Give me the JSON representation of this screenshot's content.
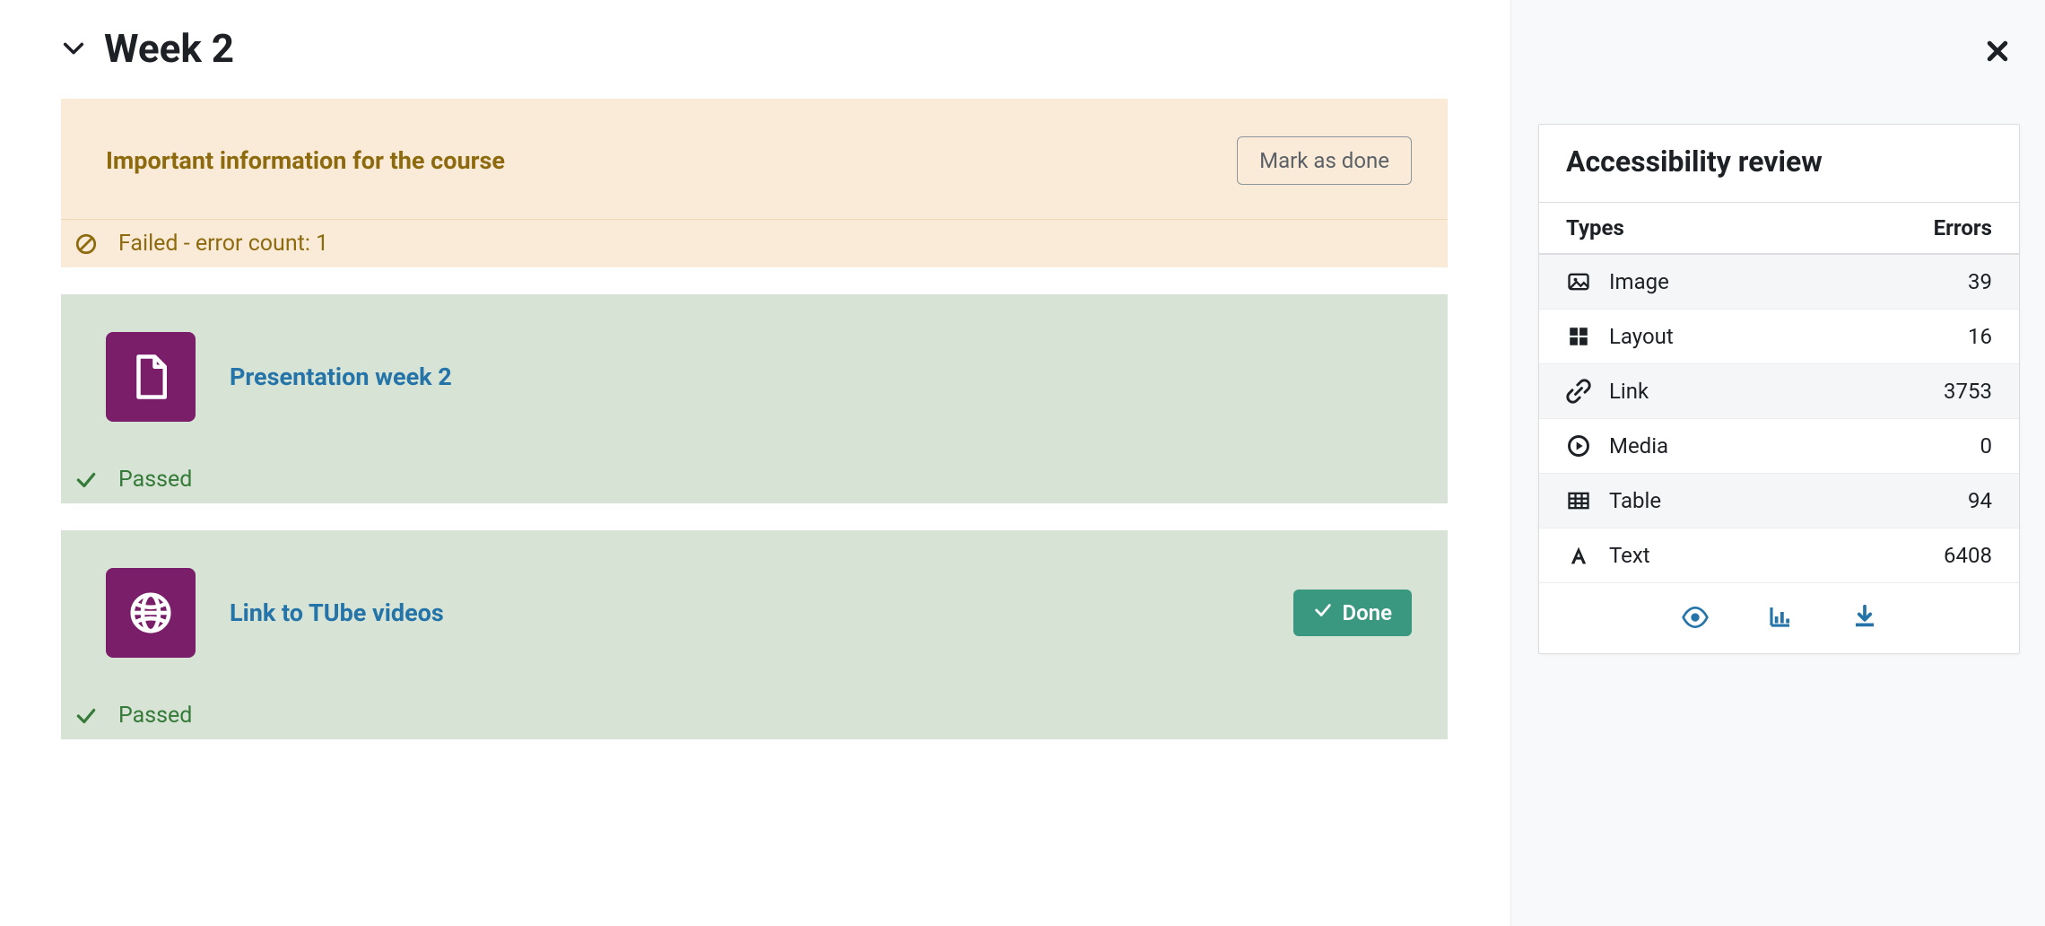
{
  "section": {
    "title": "Week 2"
  },
  "activities": [
    {
      "title": "Important information for the course",
      "status": "failed",
      "status_text": "Failed - error count: 1",
      "button": {
        "kind": "outline",
        "label": "Mark as done"
      },
      "icon": null
    },
    {
      "title": "Presentation week 2",
      "status": "passed",
      "status_text": "Passed",
      "button": null,
      "icon": "page"
    },
    {
      "title": "Link to TUbe videos",
      "status": "passed",
      "status_text": "Passed",
      "button": {
        "kind": "solid",
        "label": "Done"
      },
      "icon": "globe"
    }
  ],
  "panel": {
    "title": "Accessibility review",
    "headers": {
      "types": "Types",
      "errors": "Errors"
    },
    "rows": [
      {
        "icon": "image",
        "label": "Image",
        "count": 39
      },
      {
        "icon": "layout",
        "label": "Layout",
        "count": 16
      },
      {
        "icon": "link",
        "label": "Link",
        "count": 3753
      },
      {
        "icon": "media",
        "label": "Media",
        "count": 0
      },
      {
        "icon": "table",
        "label": "Table",
        "count": 94
      },
      {
        "icon": "text",
        "label": "Text",
        "count": 6408
      }
    ]
  }
}
